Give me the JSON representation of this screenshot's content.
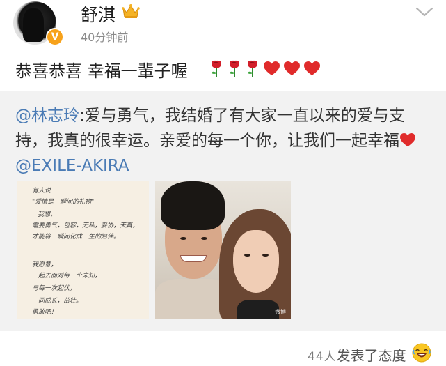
{
  "post": {
    "username": "舒淇",
    "timestamp": "40分钟前",
    "text": "恭喜恭喜 幸福一輩子喔",
    "emojis": [
      "rose",
      "rose",
      "rose",
      "red-heart",
      "red-heart",
      "red-heart"
    ]
  },
  "repost": {
    "author": "@林志玲",
    "text_part1": ":爱与勇气，我结婚了",
    "glyph": "",
    "text_part2": "有大家一直以来的爱与支持，我真的很幸运。亲爱的每一个你，让我们一起幸福",
    "mention": "@EXILE-AKIRA"
  },
  "handwriting": {
    "lines": [
      "有人说",
      "\"爱情是一瞬间的礼物\"",
      "我想，",
      "需要勇气，包容，无私，妥协，天真，",
      "才能将一瞬间化成一生的陪伴。",
      "",
      "我愿意，",
      "一起去面对每一个未知，",
      "与每一次起伏，",
      "一同成长，茁壮。",
      "勇敢吧！"
    ]
  },
  "photo": {
    "watermark": "微博"
  },
  "footer": {
    "reaction_count": "44人",
    "reaction_text": "发表了态度"
  },
  "colors": {
    "mention": "#4a7bb5",
    "repost_bg": "#f2f2f2",
    "verified": "#f7a21b",
    "heart": "#e02b2b",
    "timestamp": "#8a8a8a"
  }
}
